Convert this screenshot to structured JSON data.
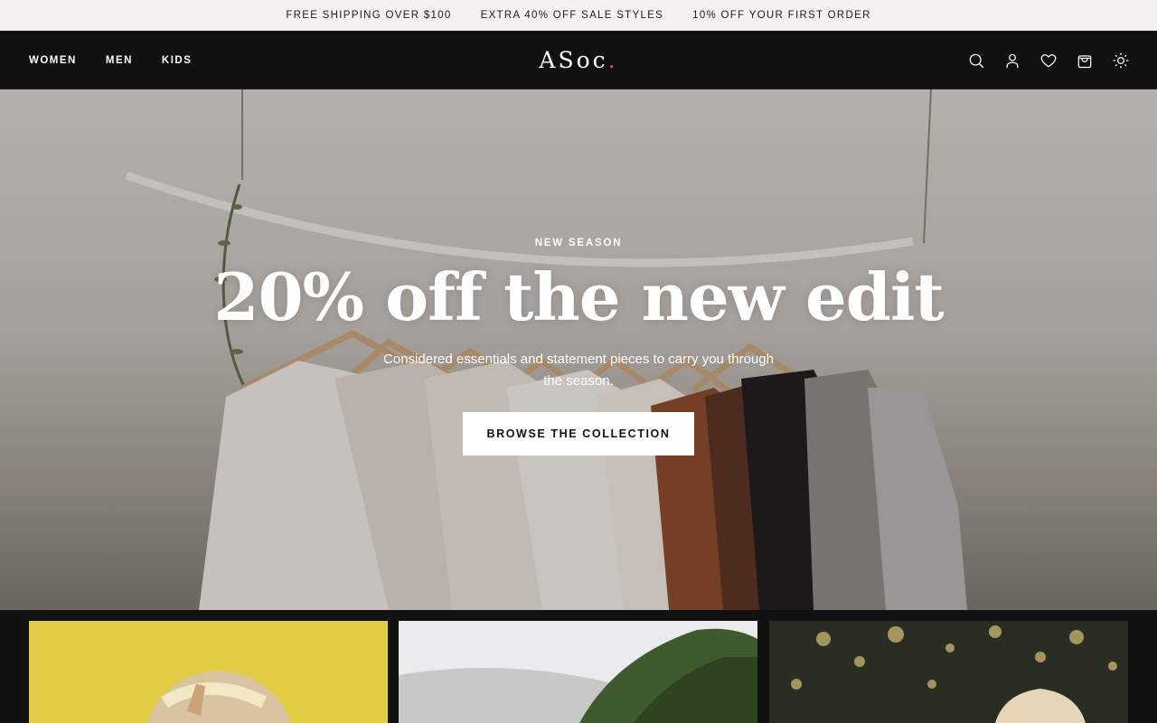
{
  "announcement": {
    "items": [
      "FREE SHIPPING OVER $100",
      "EXTRA 40% OFF SALE STYLES",
      "10% OFF YOUR FIRST ORDER"
    ]
  },
  "header": {
    "nav": [
      "WOMEN",
      "MEN",
      "KIDS"
    ],
    "logo": "ASoc",
    "logo_dot": ".",
    "icons": [
      "search-icon",
      "account-icon",
      "wishlist-icon",
      "cart-icon",
      "theme-toggle-icon"
    ]
  },
  "hero": {
    "eyebrow": "NEW SEASON",
    "headline": "20% off the new edit",
    "subtext": "Considered essentials and statement pieces to carry you through the season.",
    "cta": "BROWSE THE COLLECTION"
  },
  "colors": {
    "announcement_bg": "#f4f2ee",
    "header_bg": "#111111",
    "logo_accent": "#e0463a",
    "cta_bg": "#ffffff"
  }
}
